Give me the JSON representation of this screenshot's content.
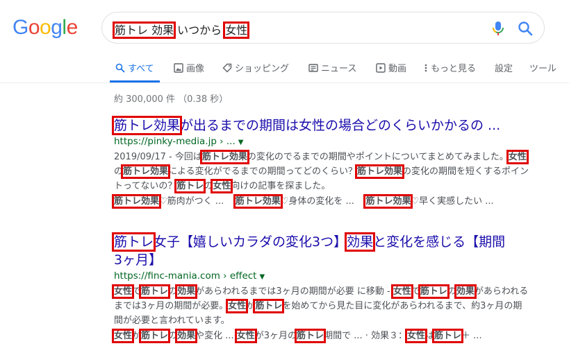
{
  "logo": {
    "letters": [
      "G",
      "o",
      "o",
      "g",
      "l",
      "e"
    ]
  },
  "search": {
    "query_parts": [
      "筋トレ 効果",
      " いつから ",
      "女性"
    ]
  },
  "tabs": [
    {
      "label": "すべて",
      "icon": "search-icon"
    },
    {
      "label": "画像",
      "icon": "image-icon"
    },
    {
      "label": "ショッピング",
      "icon": "tag-icon"
    },
    {
      "label": "ニュース",
      "icon": "news-icon"
    },
    {
      "label": "動画",
      "icon": "play-icon"
    },
    {
      "label": "もっと見る",
      "icon": "more-vert-icon"
    },
    {
      "label": "設定",
      "icon": ""
    },
    {
      "label": "ツール",
      "icon": ""
    }
  ],
  "stats": "約 300,000 件 （0.38 秒）",
  "results": [
    {
      "title_hl": "筋トレ効果",
      "title_rest": "が出るまでの期間は女性の場合どのくらいかかるの ...",
      "url": "https://pinky-media.jp › ...",
      "snippet": {
        "date": "2019/09/17 - 今回は",
        "b1": "筋トレ効果",
        "t1": "の変化のでるまでの期間やポイントについてまとめてみました。",
        "b2": "女性",
        "t2": "の",
        "b3": "筋トレ効果",
        "t3": "による変化がでるまでの期間ってどのくらい？",
        "b4": "筋トレ効果",
        "t4": "の変化の期間を短くするポイントってないの？",
        "b5": "筋トレ",
        "t5": "の",
        "b6": "女性",
        "t6": "向けの記事を探ました。"
      },
      "links": [
        {
          "b": "筋トレ効果",
          "t": "♡筋肉がつく ..."
        },
        {
          "b": "筋トレ効果",
          "t": "♡身体の変化を ..."
        },
        {
          "b": "筋トレ効果",
          "t": "♡早く実感したい ..."
        }
      ]
    },
    {
      "title_hl1": "筋トレ",
      "title_mid": "女子【嬉しいカラダの変化3つ】",
      "title_hl2": "効果",
      "title_rest": "と変化を感じる【期間",
      "title_line2": "3ヶ月】",
      "url": "https://finc-mania.com › effect",
      "snippet": {
        "b1": "女性",
        "t1": "で",
        "b2": "筋トレ",
        "t2": "の",
        "b3": "効果",
        "t3": "があらわれるまでは3ヶ月の期間が必要",
        "t3b": "に移動 -",
        "b4": "女性",
        "t4": "で",
        "b5": "筋トレ",
        "t5": "の",
        "b6": "効果",
        "t6": "があらわれるまでは3ヶ月の期間が必要。",
        "b7": "女性",
        "t7": "が",
        "b8": "筋トレ",
        "t8": "を始めてから見た目に変化があらわれるまで、約3ヶ月の期間が必要と言われています。"
      },
      "links": [
        {
          "b": "女性",
          "t": "が"
        },
        {
          "b": "筋トレ",
          "t": "の"
        },
        {
          "b": "効果",
          "t": "や変化 ..."
        },
        {
          "b": "女性",
          "t": "が3ヶ月の"
        },
        {
          "b": "筋トレ",
          "t": "期間で ... · 効果３："
        },
        {
          "b": "女性",
          "t": "は"
        },
        {
          "b": "筋トレ",
          "t": "＋ ..."
        }
      ]
    }
  ]
}
